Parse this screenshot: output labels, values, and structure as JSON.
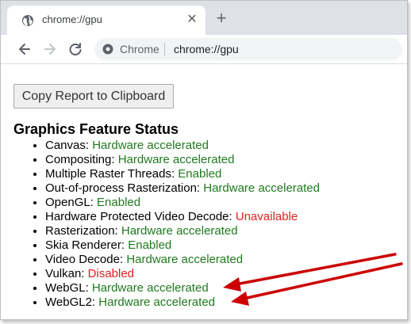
{
  "browser": {
    "tab": {
      "title": "chrome://gpu"
    },
    "omnibox": {
      "site": "Chrome",
      "url": "chrome://gpu"
    }
  },
  "page": {
    "copy_button_label": "Copy Report to Clipboard",
    "heading": "Graphics Feature Status",
    "features": [
      {
        "name": "Canvas: ",
        "status": "Hardware accelerated"
      },
      {
        "name": "Compositing: ",
        "status": "Hardware accelerated"
      },
      {
        "name": "Multiple Raster Threads: ",
        "status": "Enabled"
      },
      {
        "name": "Out-of-process Rasterization: ",
        "status": "Hardware accelerated"
      },
      {
        "name": "OpenGL: ",
        "status": "Enabled"
      },
      {
        "name": "Hardware Protected Video Decode: ",
        "status": "Unavailable"
      },
      {
        "name": "Rasterization: ",
        "status": "Hardware accelerated"
      },
      {
        "name": "Skia Renderer: ",
        "status": "Enabled"
      },
      {
        "name": "Video Decode: ",
        "status": "Hardware accelerated"
      },
      {
        "name": "Vulkan: ",
        "status": "Disabled"
      },
      {
        "name": "WebGL: ",
        "status": "Hardware accelerated"
      },
      {
        "name": "WebGL2: ",
        "status": "Hardware accelerated"
      }
    ]
  },
  "colors": {
    "enabled": "#1f7a1f",
    "disabled": "#e02020",
    "annotation_arrow": "#cc0000"
  },
  "icons": [
    "globe-icon",
    "close-icon",
    "plus-icon",
    "back-arrow-icon",
    "forward-arrow-icon",
    "reload-icon",
    "info-icon",
    "annotation-arrow"
  ]
}
